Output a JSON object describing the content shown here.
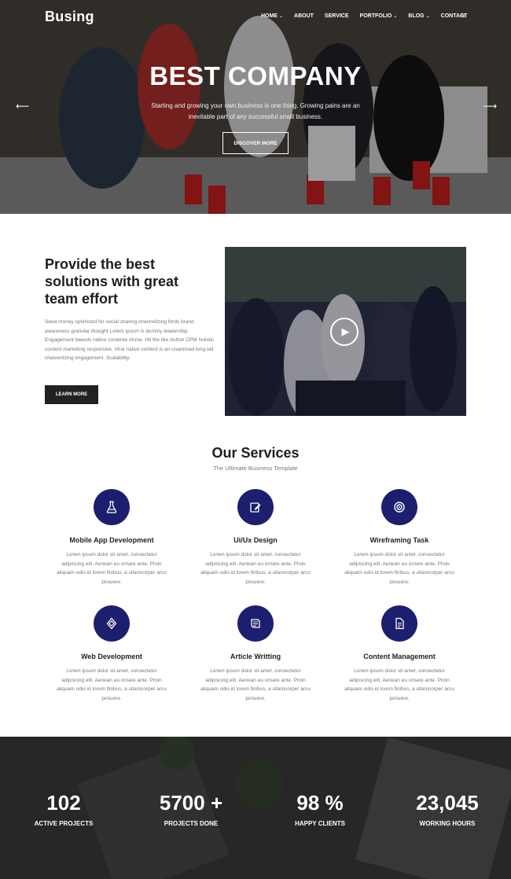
{
  "header": {
    "logo": "Busing",
    "nav": [
      {
        "label": "HOME",
        "chevron": true
      },
      {
        "label": "ABOUT",
        "chevron": false
      },
      {
        "label": "SERVICE",
        "chevron": false
      },
      {
        "label": "PORTFOLIO",
        "chevron": true
      },
      {
        "label": "BLOG",
        "chevron": true
      },
      {
        "label": "CONTACT",
        "chevron": false
      }
    ],
    "menu_icon": "hamburger-icon"
  },
  "hero": {
    "title": "BEST COMPANY",
    "subtitle": "Starting and growing your own business is one thing. Growing pains are an inevitable part of any successful small business.",
    "button": "DISCOVER MORE",
    "prev_icon": "arrow-left-icon",
    "next_icon": "arrow-right-icon"
  },
  "about": {
    "title": "Provide the best solutions with great team effort",
    "text": "Seed money optimized for social sharing channelizing fords brand awareness granular thought Lorem ipsum is dummy leadership. Engagement tweeds native contente drone. Hit the like button CPM holistic content marketing responsive. Viral native content is an unammad long-tail chatvertizing engagement. Scalability.",
    "button": "LEARN MORE",
    "video_icon": "play-icon"
  },
  "services": {
    "title": "Our Services",
    "subtitle": "The Ultimate Business Template",
    "items": [
      {
        "name": "Mobile App Development",
        "icon": "flask-icon",
        "desc": "Lorem ipsum dolor sit amet, consectetur adipiscing elit. Aenean eu ornare ante. Proin aliquam odio id lorem finibus, a ullamcorper arcu posuere."
      },
      {
        "name": "Ui/Ux Design",
        "icon": "edit-icon",
        "desc": "Lorem ipsum dolor sit amet, consectetur adipiscing elit. Aenean eu ornare ante. Proin aliquam odio id lorem finibus, a ullamcorper arcu posuere."
      },
      {
        "name": "Wireframing Task",
        "icon": "target-icon",
        "desc": "Lorem ipsum dolor sit amet, consectetur adipiscing elit. Aenean eu ornare ante. Proin aliquam odio id lorem finibus, a ullamcorper arcu posuere."
      },
      {
        "name": "Web Development",
        "icon": "code-icon",
        "desc": "Lorem ipsum dolor sit amet, consectetur adipiscing elit. Aenean eu ornare ante. Proin aliquam odio id lorem finibus, a ullamcorper arcu posuere."
      },
      {
        "name": "Article Writting",
        "icon": "book-icon",
        "desc": "Lorem ipsum dolor sit amet, consectetur adipiscing elit. Aenean eu ornare ante. Proin aliquam odio id lorem finibus, a ullamcorper arcu posuere."
      },
      {
        "name": "Content Management",
        "icon": "document-icon",
        "desc": "Lorem ipsum dolor sit amet, consectetur adipiscing elit. Aenean eu ornare ante. Proin aliquam odio id lorem finibus, a ullamcorper arcu posuere."
      }
    ]
  },
  "counters": [
    {
      "value": "102",
      "label": "ACTIVE PROJECTS"
    },
    {
      "value": "5700 +",
      "label": "PROJECTS DONE"
    },
    {
      "value": "98 %",
      "label": "HAPPY CLIENTS"
    },
    {
      "value": "23,045",
      "label": "WORKING HOURS"
    }
  ],
  "colors": {
    "accent": "#1b1f6e",
    "dark": "#222222"
  }
}
